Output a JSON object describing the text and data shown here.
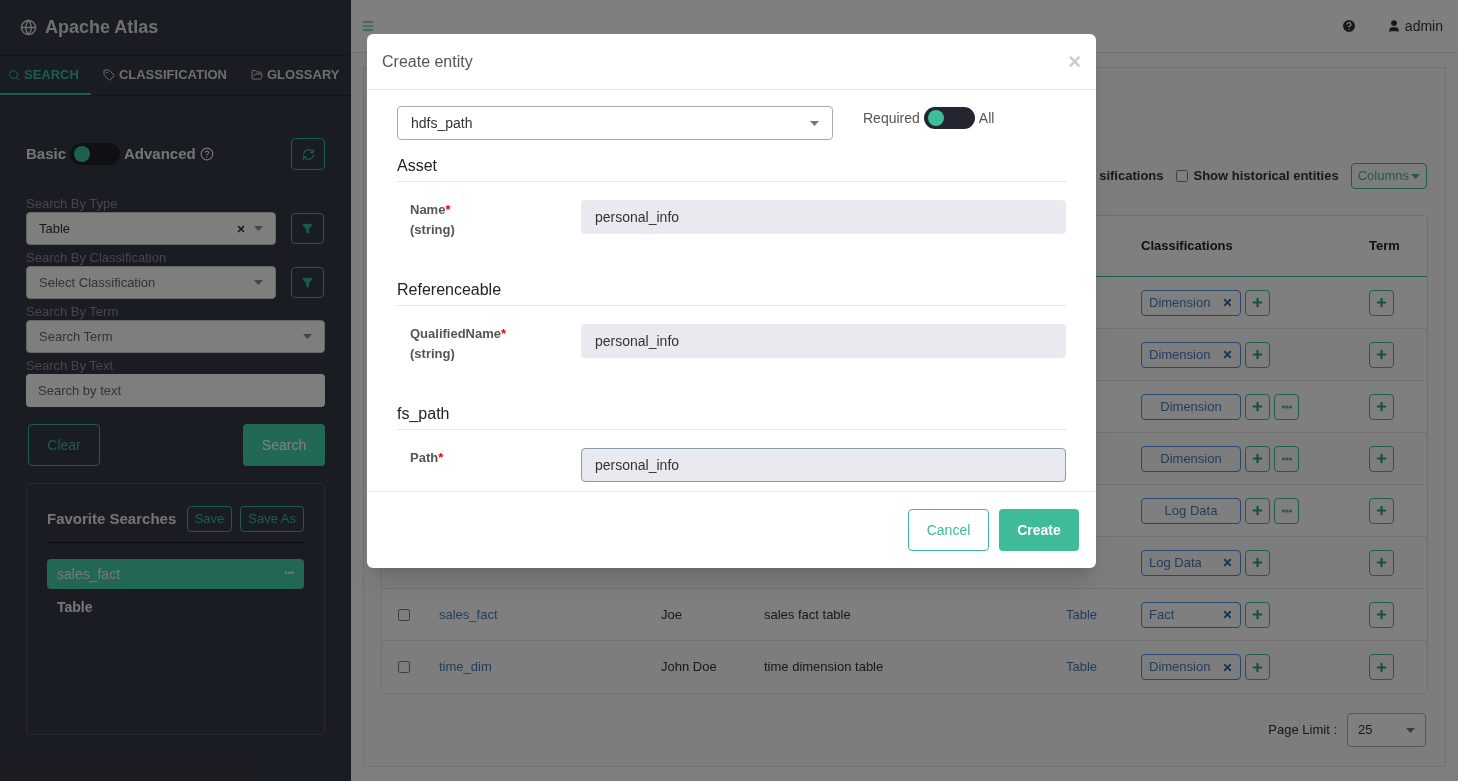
{
  "sidebar": {
    "logo": "Apache Atlas",
    "tabs": [
      {
        "label": "SEARCH",
        "selected": true
      },
      {
        "label": "CLASSIFICATION",
        "selected": false
      },
      {
        "label": "GLOSSARY",
        "selected": false
      }
    ],
    "mode": {
      "left": "Basic",
      "right": "Advanced",
      "advanced": false
    },
    "filters": [
      {
        "label": "Search By Type",
        "kind": "select",
        "value": "Table",
        "clearable": true,
        "filter_button": true
      },
      {
        "label": "Search By Classification",
        "kind": "select",
        "placeholder": "Select Classification",
        "filter_button": true
      },
      {
        "label": "Search By Term",
        "kind": "select",
        "placeholder": "Search Term"
      },
      {
        "label": "Search By Text",
        "kind": "text",
        "placeholder": "Search by text"
      }
    ],
    "clear_button": "Clear",
    "search_button": "Search",
    "favorites": {
      "title": "Favorite Searches",
      "buttons": [
        "Save",
        "Save As"
      ],
      "items": [
        {
          "label": "sales_fact",
          "selected": true,
          "menu": "•••"
        },
        {
          "label": "Table",
          "selected": false
        }
      ]
    }
  },
  "topbar": {
    "user": "admin"
  },
  "toolbar": {
    "cut_label": "sifications",
    "option": {
      "label": "Show historical entities",
      "checked": false
    },
    "columns_button": "Columns"
  },
  "table": {
    "columns": [
      "Classifications",
      "Term"
    ],
    "rows": [
      {
        "tag": "Dimension",
        "removable": true,
        "more": false
      },
      {
        "tag": "Dimension",
        "removable": true,
        "more": false
      },
      {
        "tag": "Dimension",
        "removable": false,
        "more": true
      },
      {
        "tag": "Dimension",
        "removable": false,
        "more": true
      },
      {
        "tag": "Log Data",
        "removable": false,
        "more": true
      },
      {
        "tag": "Log Data",
        "removable": true,
        "more": false
      },
      {
        "checked": false,
        "name": "sales_fact",
        "owner": "Joe",
        "description": "sales fact table",
        "type": "Table",
        "tag": "Fact",
        "removable": true,
        "more": false
      },
      {
        "checked": false,
        "name": "time_dim",
        "owner": "John Doe",
        "description": "time dimension table",
        "type": "Table",
        "tag": "Dimension",
        "removable": true,
        "more": false
      }
    ]
  },
  "pagination": {
    "label": "Page Limit :",
    "value": "25"
  },
  "modal": {
    "title": "Create entity",
    "close": "×",
    "type_value": "hdfs_path",
    "toggle": {
      "left": "Required",
      "right": "All",
      "all": false
    },
    "sections": [
      {
        "title": "Asset",
        "fields": [
          {
            "label": "Name",
            "required_mark": "*",
            "type": "(string)",
            "value": "personal_info",
            "focused": false
          }
        ]
      },
      {
        "title": "Referenceable",
        "fields": [
          {
            "label": "QualifiedName",
            "required_mark": "*",
            "type": "(string)",
            "value": "personal_info",
            "focused": false
          }
        ]
      },
      {
        "title": "fs_path",
        "fields": [
          {
            "label": "Path",
            "required_mark": "*",
            "value": "personal_info",
            "focused": true
          }
        ]
      }
    ],
    "buttons": [
      {
        "label": "Cancel",
        "kind": "secondary"
      },
      {
        "label": "Create",
        "kind": "primary"
      }
    ]
  }
}
